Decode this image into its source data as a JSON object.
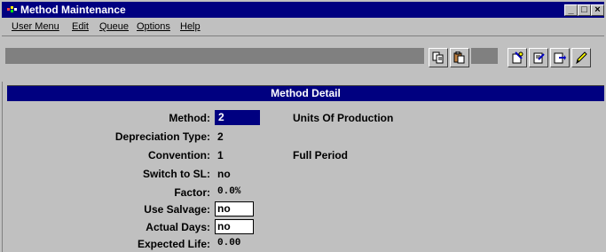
{
  "window": {
    "title": "Method Maintenance",
    "controls": {
      "minimize": "_",
      "maximize": "□",
      "close": "×"
    }
  },
  "menubar": {
    "items": [
      {
        "label": "User Menu"
      },
      {
        "label": "Edit"
      },
      {
        "label": "Queue"
      },
      {
        "label": "Options"
      },
      {
        "label": "Help"
      }
    ]
  },
  "toolbar": {
    "icons": [
      "copy-icon",
      "paste-icon",
      "query-icon",
      "edit-record-icon",
      "forward-record-icon",
      "pencil-icon"
    ]
  },
  "section": {
    "title": "Method Detail"
  },
  "form": {
    "method": {
      "label": "Method:",
      "value": "2",
      "description": "Units Of Production"
    },
    "depreciation_type": {
      "label": "Depreciation Type:",
      "value": "2"
    },
    "convention": {
      "label": "Convention:",
      "value": "1",
      "description": "Full Period"
    },
    "switch_to_sl": {
      "label": "Switch to SL:",
      "value": "no"
    },
    "factor": {
      "label": "Factor:",
      "value": "0.0%"
    },
    "use_salvage": {
      "label": "Use Salvage:",
      "value": "no"
    },
    "actual_days": {
      "label": "Actual Days:",
      "value": "no"
    },
    "expected_life": {
      "label": "Expected Life:",
      "value": "0.00"
    }
  },
  "colors": {
    "titlebar": "#000080",
    "chrome": "#c0c0c0",
    "toolbar_strip": "#808080",
    "selection": "#000080"
  }
}
